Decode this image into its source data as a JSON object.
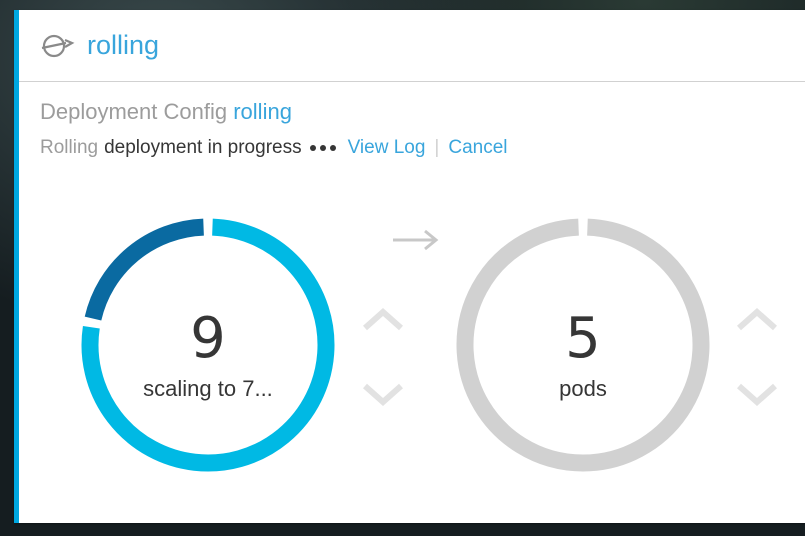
{
  "header": {
    "title": "rolling",
    "icon": "rolling-deployment-icon"
  },
  "deployment": {
    "prefix": "Deployment Config",
    "name": "rolling"
  },
  "status": {
    "strategy": "Rolling",
    "text": "deployment in progress",
    "view_log": "View Log",
    "separator": "|",
    "cancel": "Cancel"
  },
  "old_pods": {
    "count": "9",
    "label": "scaling to 7...",
    "scaled_fraction": 0.22
  },
  "new_pods": {
    "count": "5",
    "label": "pods"
  },
  "colors": {
    "accent": "#39a5dc",
    "ring_active": "#00b9e4",
    "ring_scaling": "#0a6aa1",
    "ring_idle": "#d1d1d1",
    "border": "#00a8e1"
  }
}
